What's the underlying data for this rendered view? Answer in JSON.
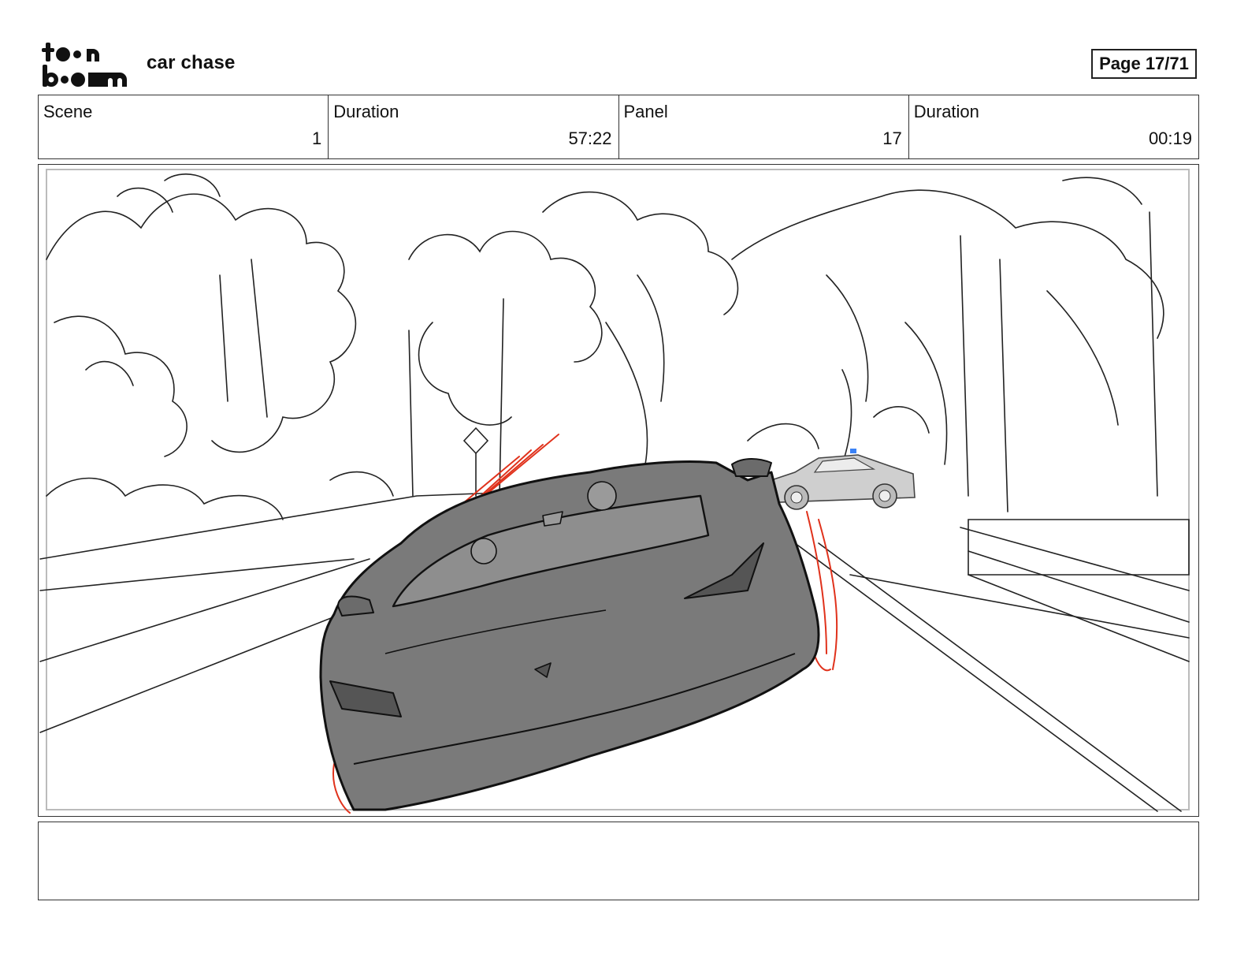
{
  "header": {
    "logo_text": "toon boom",
    "project_title": "car chase",
    "page_label": "Page 17/71"
  },
  "info": [
    {
      "label": "Scene",
      "value": "1"
    },
    {
      "label": "Duration",
      "value": "57:22"
    },
    {
      "label": "Panel",
      "value": "17"
    },
    {
      "label": "Duration",
      "value": "00:19"
    }
  ],
  "panel": {
    "sketch_colors": {
      "line": "#222222",
      "car_fill": "#7a7a7a",
      "police_car_fill": "#cfcfcf",
      "action_lines": "#e0321c",
      "siren": "#3b82f6"
    }
  },
  "notes": {
    "text": ""
  }
}
